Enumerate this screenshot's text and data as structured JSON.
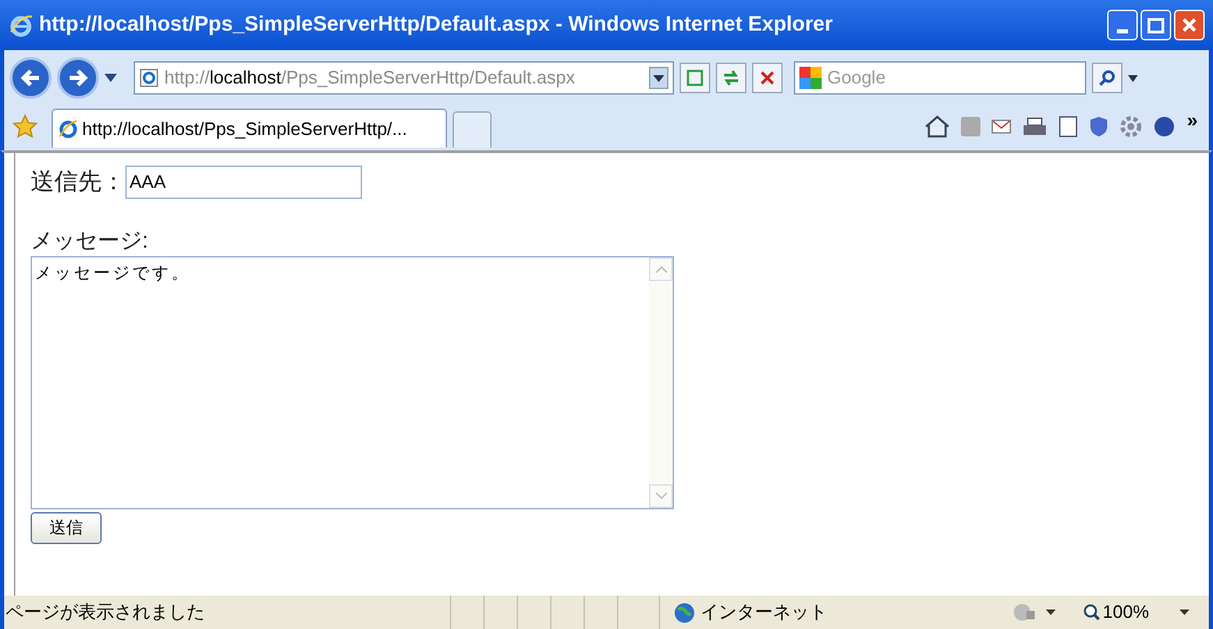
{
  "window": {
    "title": "http://localhost/Pps_SimpleServerHttp/Default.aspx - Windows Internet Explorer"
  },
  "address_bar": {
    "scheme": "http://",
    "host": "localhost",
    "path": "/Pps_SimpleServerHttp/Default.aspx"
  },
  "search": {
    "placeholder": "Google"
  },
  "tabs": [
    {
      "label": "http://localhost/Pps_SimpleServerHttp/...",
      "selected": true
    }
  ],
  "toolbar": {
    "overflow": "»"
  },
  "form": {
    "to_label": "送信先：",
    "to_value": "AAA",
    "message_label": "メッセージ:",
    "message_value": "メッセージです。",
    "submit": "送信"
  },
  "status_bar": {
    "text": "ページが表示されました",
    "zone": "インターネット",
    "zoom": "100%"
  }
}
